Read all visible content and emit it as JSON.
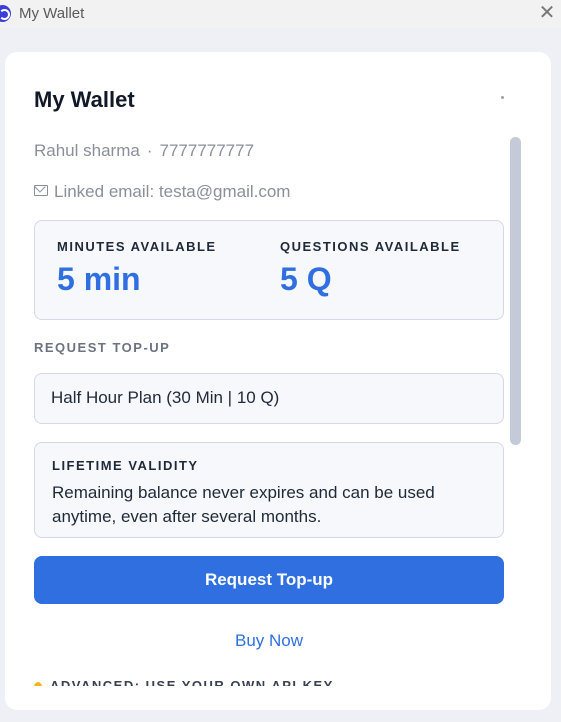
{
  "window": {
    "title": "My Wallet",
    "close_glyph": "✕",
    "app_icon": "app-logo-icon"
  },
  "wallet": {
    "heading": "My Wallet",
    "user_name": "Rahul sharma",
    "separator": "·",
    "phone": "7777777777",
    "email_label": "Linked email: testa@gmail.com",
    "email_icon": "envelope-icon"
  },
  "stats": {
    "minutes_label": "MINUTES AVAILABLE",
    "minutes_value": "5 min",
    "questions_label": "QUESTIONS AVAILABLE",
    "questions_value": "5 Q"
  },
  "topup": {
    "section_label": "REQUEST TOP-UP",
    "selected_plan": "Half Hour Plan (30 Min | 10 Q)"
  },
  "validity": {
    "title": "LIFETIME VALIDITY",
    "text": "Remaining balance never expires and can be used anytime, even after several months."
  },
  "actions": {
    "request_button": "Request Top-up",
    "buy_now": "Buy Now"
  },
  "advanced": {
    "label": "ADVANCED: USE YOUR OWN API KEY",
    "icon": "lightbulb-icon"
  },
  "colors": {
    "accent": "#2f6fe0",
    "scrollbar": "#c4cad8",
    "panel_border": "#d3d8e6"
  }
}
